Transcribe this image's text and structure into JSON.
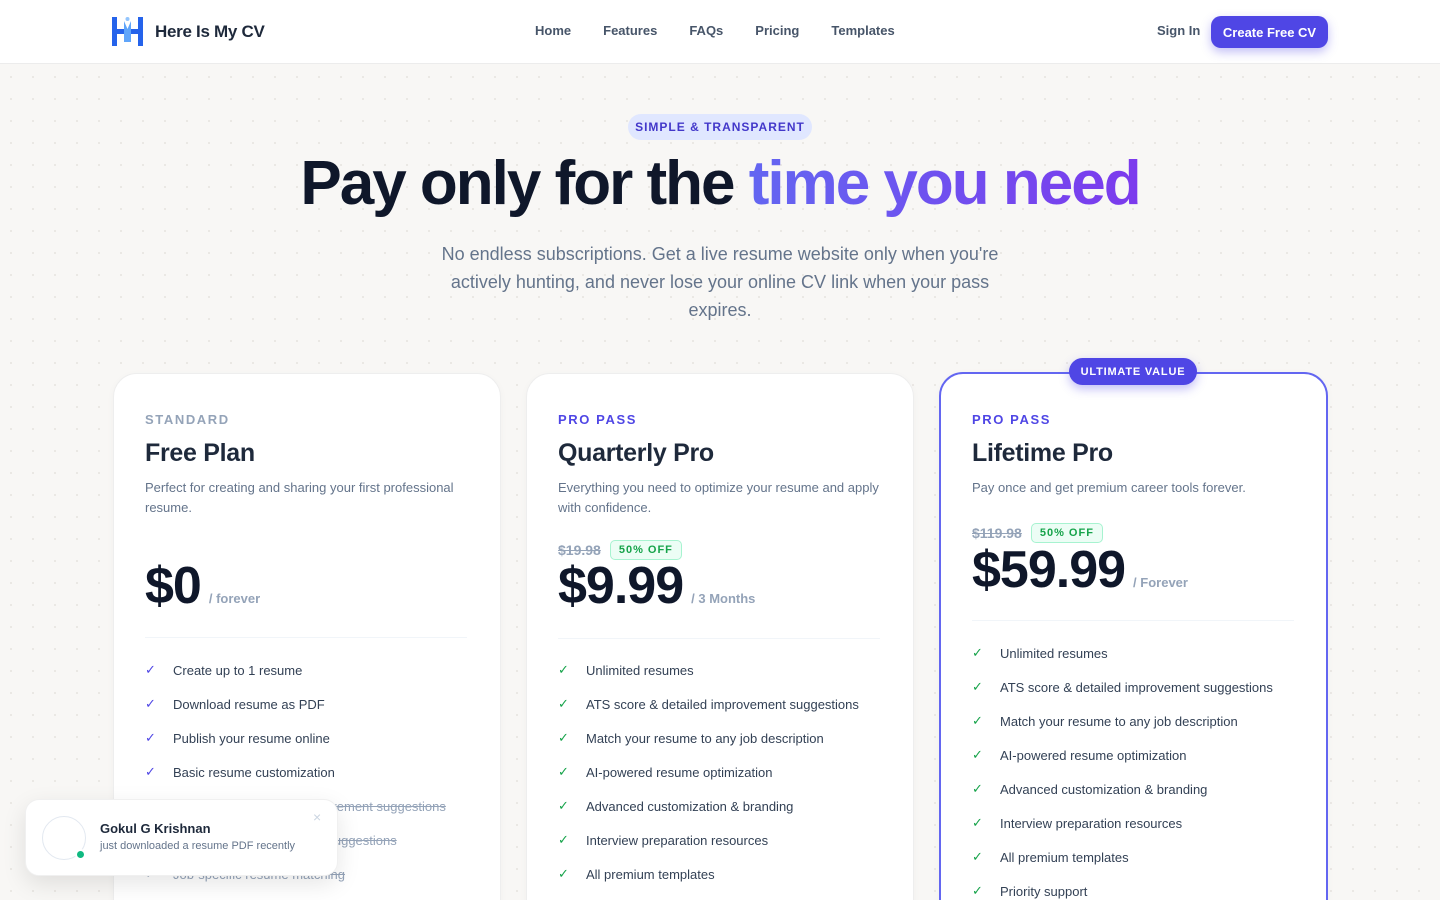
{
  "brand": {
    "name": "Here Is My CV",
    "icon": "hm-logo-icon",
    "color": "#2563eb"
  },
  "nav": {
    "links": [
      "Home",
      "Features",
      "FAQs",
      "Pricing",
      "Templates"
    ],
    "signin": "Sign In",
    "cta": "Create Free CV"
  },
  "hero": {
    "pill": "SIMPLE & TRANSPARENT",
    "title_plain": "Pay only for the ",
    "title_accent": "time you need",
    "subtitle": "No endless subscriptions. Get a live resume website only when you're actively hunting, and never lose your online CV link when your pass expires."
  },
  "colors": {
    "accent": "#4f46e5",
    "success": "#16a34a",
    "text": "#0f172a",
    "muted": "#64748b"
  },
  "plans": [
    {
      "tier": "STANDARD",
      "name": "Free Plan",
      "description": "Perfect for creating and sharing your first professional resume.",
      "price": "$0",
      "period": "/ forever",
      "features": [
        {
          "text": "Create up to 1 resume",
          "included": true
        },
        {
          "text": "Download resume as PDF",
          "included": true
        },
        {
          "text": "Publish your resume online",
          "included": true
        },
        {
          "text": "Basic resume customization",
          "included": true
        },
        {
          "text": "ATS score & detailed improvement suggestions",
          "included": false
        },
        {
          "text": "ATS score & improvement suggestions",
          "included": false
        },
        {
          "text": "Job-specific resume matching",
          "included": false
        }
      ]
    },
    {
      "tier": "PRO PASS",
      "name": "Quarterly Pro",
      "description": "Everything you need to optimize your resume and apply with confidence.",
      "old_price": "$19.98",
      "discount": "50% OFF",
      "price": "$9.99",
      "period": "/ 3 Months",
      "features": [
        {
          "text": "Unlimited resumes",
          "included": true
        },
        {
          "text": "ATS score & detailed improvement suggestions",
          "included": true
        },
        {
          "text": "Match your resume to any job description",
          "included": true
        },
        {
          "text": "AI-powered resume optimization",
          "included": true
        },
        {
          "text": "Advanced customization & branding",
          "included": true
        },
        {
          "text": "Interview preparation resources",
          "included": true
        },
        {
          "text": "All premium templates",
          "included": true
        }
      ]
    },
    {
      "badge": "ULTIMATE VALUE",
      "tier": "PRO PASS",
      "name": "Lifetime Pro",
      "description": "Pay once and get premium career tools forever.",
      "old_price": "$119.98",
      "discount": "50% OFF",
      "price": "$59.99",
      "period": "/ Forever",
      "features": [
        {
          "text": "Unlimited resumes",
          "included": true
        },
        {
          "text": "ATS score & detailed improvement suggestions",
          "included": true
        },
        {
          "text": "Match your resume to any job description",
          "included": true
        },
        {
          "text": "AI-powered resume optimization",
          "included": true
        },
        {
          "text": "Advanced customization & branding",
          "included": true
        },
        {
          "text": "Interview preparation resources",
          "included": true
        },
        {
          "text": "All premium templates",
          "included": true
        },
        {
          "text": "Priority support",
          "included": true
        }
      ]
    }
  ],
  "toast": {
    "name": "Gokul G Krishnan",
    "message": "just downloaded a resume PDF recently",
    "close": "×",
    "check_glyph": "✓"
  }
}
